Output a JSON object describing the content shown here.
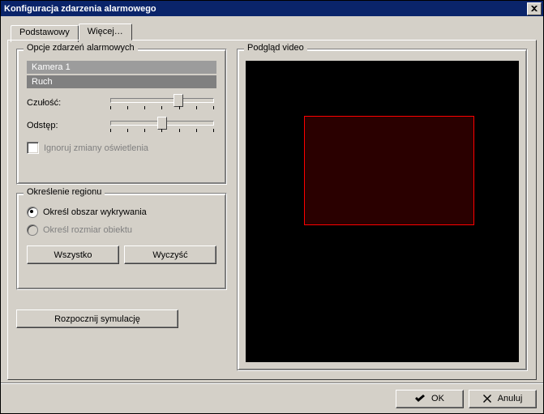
{
  "title": "Konfiguracja zdarzenia alarmowego",
  "tabs": {
    "basic": "Podstawowy",
    "more": "Więcej…"
  },
  "opts": {
    "group_label": "Opcje zdarzeń alarmowych",
    "camera_label": "Kamera 1",
    "motion_label": "Ruch",
    "sensitivity_label": "Czułość:",
    "sensitivity_value_pct": 65,
    "interval_label": "Odstęp:",
    "interval_value_pct": 50,
    "ignore_lighting_label": "Ignoruj zmiany oświetlenia",
    "ignore_lighting_checked": false
  },
  "region": {
    "group_label": "Określenie regionu",
    "option_detect": "Określ obszar wykrywania",
    "option_size": "Określ rozmiar obiektu",
    "selected": "detect",
    "btn_all": "Wszystko",
    "btn_clear": "Wyczyść"
  },
  "sim": {
    "btn": "Rozpocznij symulację"
  },
  "video": {
    "group_label": "Podgląd video"
  },
  "footer": {
    "ok": "OK",
    "cancel": "Anuluj"
  }
}
